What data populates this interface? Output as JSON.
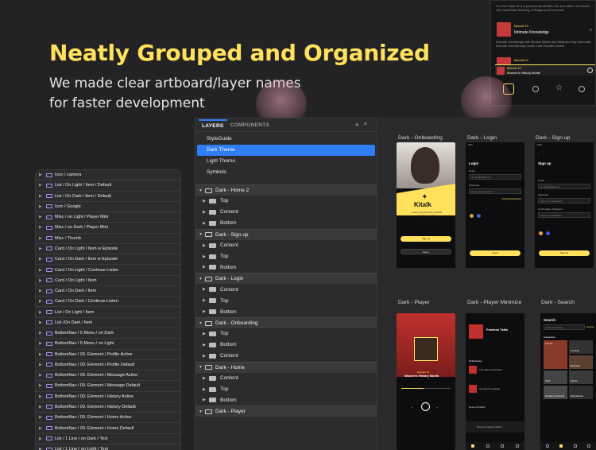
{
  "hero": {
    "title": "Neatly Grouped and Organized",
    "subtitle": "We made clear artboard/layer names for faster development"
  },
  "symbols": [
    "Icon / camera",
    "List / On Light / Item / Default",
    "List / On Dark / Item / Default",
    "Icon / Google",
    "Misc / on Light / Player Mini",
    "Misc / on Dark / Player Mini",
    "Misc / Thumb",
    "Card / On Light / Item w Episode",
    "Card / On Dark / Item w Episode",
    "Card / On Light / Continue Listen",
    "Card / On Light / Item",
    "Card / On Dark / Item",
    "Card / On Dark / Continue Listen",
    "List / On Light / Item",
    "List /On Dark / Item",
    "BottomNav / 5 Menu / on Dark",
    "BottomNav / 5 Menu / on Light",
    "BottomNav / 00. Element / Profile Active",
    "BottomNav / 00. Element / Profile Default",
    "BottomNav / 00. Element / Message Active",
    "BottomNav / 00. Element / Message Default",
    "BottomNav / 00. Element / History Active",
    "BottomNav / 00. Element / History Default",
    "BottomNav / 00. Element / Home Active",
    "BottomNav / 00. Element / Home Default",
    "List / 1 Line / on Dark / Text",
    "List / 1 Line / on Light / Text"
  ],
  "layers_panel": {
    "tab_layers": "LAYERS",
    "tab_components": "COMPONENTS",
    "add_symbol": "+",
    "collapse_symbol": "^",
    "pages": [
      "StyleGuide",
      "Dark Theme",
      "Light Theme",
      "Symbols"
    ],
    "selected_page": "Dark Theme",
    "artboards": [
      {
        "name": "Dark - Home 2",
        "groups": [
          "Top",
          "Content",
          "Bottom"
        ]
      },
      {
        "name": "Dark - Sign up",
        "groups": [
          "Content",
          "Top",
          "Bottom"
        ]
      },
      {
        "name": "Dark - Login",
        "groups": [
          "Content",
          "Top",
          "Bottom"
        ]
      },
      {
        "name": "Dark - Onboarding",
        "groups": [
          "Top",
          "Bottom",
          "Content"
        ]
      },
      {
        "name": "Dark - Home",
        "groups": [
          "Content",
          "Top",
          "Bottom"
        ]
      },
      {
        "name": "Dark - Player",
        "groups": []
      }
    ]
  },
  "artboards_view": {
    "labels": [
      "Dark - Onboarding",
      "Dark - Login",
      "Dark - Sign up",
      "Dark - Player",
      "Dark - Player Minimize",
      "Dark - Search"
    ],
    "onboarding": {
      "brand": "Kitalk",
      "tagline": "Listen your favourite podcast anywhere, anytime",
      "signup": "Sign up",
      "login": "Log in"
    },
    "login": {
      "title": "Login",
      "email_label": "Email",
      "email_value": "dc.dev@kitalk.com",
      "password_label": "Password",
      "password_placeholder": "Input your password",
      "forgot": "Forgot Password?",
      "button": "Log In"
    },
    "signup": {
      "title": "Sign up",
      "email_label": "Email",
      "email_value": "dc.dev@kitalk.com",
      "password_label": "Password",
      "password_placeholder": "Input your password",
      "confirm_label": "Confirmation Password",
      "confirm_placeholder": "Input your password",
      "button": "Sign up"
    },
    "player": {
      "episode": "Episode 10",
      "title": "Women's History Month"
    },
    "player_min": {
      "show": "Fearless Talks",
      "episodes_label": "All Episodes",
      "ep1": "The Sake Of Fearless",
      "ep2": "Intimate Knowledge",
      "ep3": "Women's History Month",
      "news": "News & Politics",
      "now": "Women's History Month"
    },
    "search": {
      "title": "Search",
      "placeholder": "Search Podcast",
      "cancel": "Cancel",
      "categories": "Categories",
      "cats": [
        "Top 10",
        "Comedy",
        "Business",
        "Tech",
        "Society & Cultural",
        "Sports",
        "Educational"
      ]
    }
  },
  "top_panel": {
    "desc1": "For The Sake Of is a podcast about faith, life and what it all means. Join host Brian Kitching, a Religious of the heart",
    "ep_label": "Episode 10",
    "ep_title": "Intimate Knowledge",
    "desc2": "Intimate Knowledge with Brooke Burke and Meghan King Edmonds and see and intimacy coach Lola Cloutier covers",
    "ep_label2": "Episode 10",
    "now_playing_ep": "Episode 10",
    "now_playing": "Women's History Month"
  },
  "colors": {
    "accent": "#FFE15C",
    "selection": "#2F7EF5",
    "symbol_icon": "#B98BF5"
  }
}
